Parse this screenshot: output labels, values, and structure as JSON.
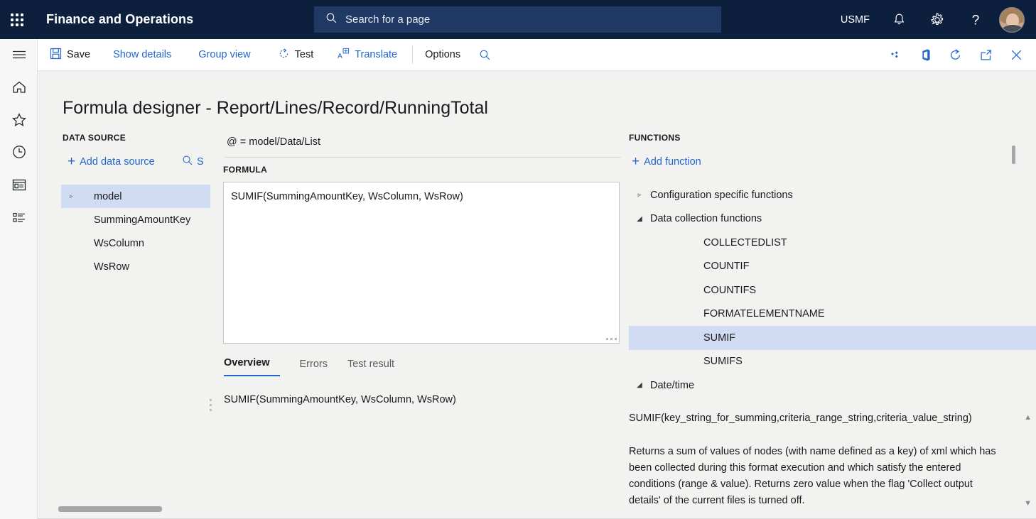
{
  "header": {
    "app_title": "Finance and Operations",
    "waffle_icon": "app-launcher-icon",
    "search": {
      "placeholder": "Search for a page",
      "icon": "search-icon"
    },
    "company": "USMF",
    "notifications_icon": "bell-icon",
    "settings_icon": "gear-icon",
    "help_icon": "question-mark-icon",
    "avatar_label": "user-avatar"
  },
  "navrail": {
    "items": [
      {
        "name": "menu-icon",
        "label": "Menu"
      },
      {
        "name": "home-icon",
        "label": "Home"
      },
      {
        "name": "star-icon",
        "label": "Favorites"
      },
      {
        "name": "clock-icon",
        "label": "Recent"
      },
      {
        "name": "workspaces-icon",
        "label": "Workspaces"
      },
      {
        "name": "modules-icon",
        "label": "Modules"
      }
    ]
  },
  "commandbar": {
    "save": "Save",
    "show_details": "Show details",
    "group_view": "Group view",
    "test": "Test",
    "translate": "Translate",
    "options": "Options",
    "search_icon": "search-icon",
    "right_icons": [
      "personalize-icon",
      "office-icon",
      "refresh-icon",
      "open-in-new-window-icon",
      "close-icon"
    ]
  },
  "page": {
    "title": "Formula designer - Report/Lines/Record/RunningTotal"
  },
  "data_source": {
    "header": "DATA SOURCE",
    "add_label": "Add data source",
    "search_label": "S",
    "tree": [
      {
        "label": "model",
        "caret": "▹",
        "selected": true,
        "indent": 0
      },
      {
        "label": "SummingAmountKey",
        "caret": "",
        "selected": false,
        "indent": 1
      },
      {
        "label": "WsColumn",
        "caret": "",
        "selected": false,
        "indent": 1
      },
      {
        "label": "WsRow",
        "caret": "",
        "selected": false,
        "indent": 1
      }
    ]
  },
  "editor": {
    "binding": "@ = model/Data/List",
    "formula_header": "FORMULA",
    "formula_value": "SUMIF(SummingAmountKey, WsColumn, WsRow)",
    "tabs": [
      {
        "label": "Overview",
        "active": true
      },
      {
        "label": "Errors",
        "active": false
      },
      {
        "label": "Test result",
        "active": false
      }
    ],
    "overview_text": "SUMIF(SummingAmountKey, WsColumn, WsRow)"
  },
  "functions": {
    "header": "FUNCTIONS",
    "add_label": "Add function",
    "tree": [
      {
        "label": "Configuration specific functions",
        "caret": "▹",
        "group": true,
        "selected": false
      },
      {
        "label": "Data collection functions",
        "caret": "◢",
        "group": true,
        "selected": false
      },
      {
        "label": "COLLECTEDLIST",
        "caret": "",
        "group": false,
        "selected": false
      },
      {
        "label": "COUNTIF",
        "caret": "",
        "group": false,
        "selected": false
      },
      {
        "label": "COUNTIFS",
        "caret": "",
        "group": false,
        "selected": false
      },
      {
        "label": "FORMATELEMENTNAME",
        "caret": "",
        "group": false,
        "selected": false
      },
      {
        "label": "SUMIF",
        "caret": "",
        "group": false,
        "selected": true
      },
      {
        "label": "SUMIFS",
        "caret": "",
        "group": false,
        "selected": false
      },
      {
        "label": "Date/time",
        "caret": "◢",
        "group": true,
        "selected": false
      }
    ],
    "description_signature": "SUMIF(key_string_for_summing,criteria_range_string,criteria_value_string)",
    "description_body": "Returns a sum of values of nodes (with name defined as a key) of xml which has been collected during this format execution and which satisfy the entered conditions (range & value). Returns zero value when the flag 'Collect output details' of the current files is turned off."
  },
  "colors": {
    "header_bg": "#0c1f3d",
    "search_bg": "#1f3864",
    "accent_link": "#2266cc",
    "selection": "#cfdcf3",
    "page_bg": "#f2f2f1"
  }
}
